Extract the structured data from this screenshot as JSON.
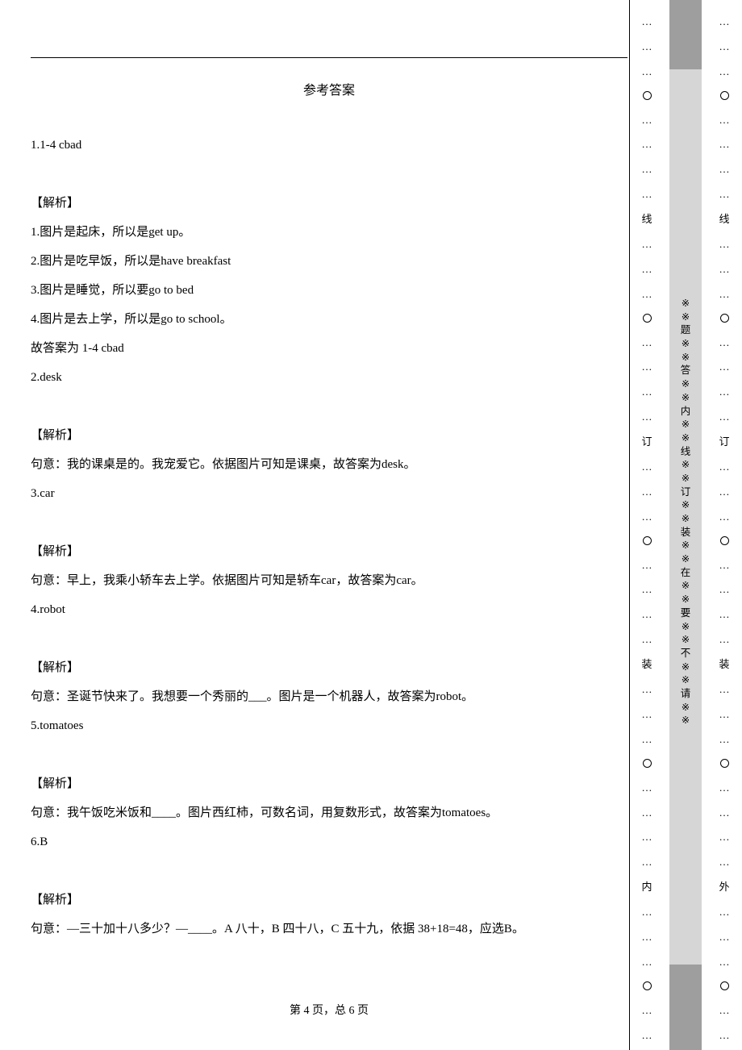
{
  "title": "参考答案",
  "lines": [
    "1.1-4 cbad",
    "",
    "【解析】",
    "1.图片是起床，所以是get up。",
    "2.图片是吃早饭，所以是have breakfast",
    "3.图片是睡觉，所以要go to bed",
    "4.图片是去上学，所以是go to school。",
    "故答案为 1-4 cbad",
    "2.desk",
    "",
    "【解析】",
    "句意：我的课桌是的。我宠爱它。依据图片可知是课桌，故答案为desk。",
    "3.car",
    "",
    "【解析】",
    "句意：早上，我乘小轿车去上学。依据图片可知是轿车car，故答案为car。",
    "4.robot",
    "",
    "【解析】",
    "句意：圣诞节快来了。我想要一个秀丽的___。图片是一个机器人，故答案为robot。",
    "5.tomatoes",
    "",
    "【解析】",
    "句意：我午饭吃米饭和____。图片西红柿，可数名词，用复数形式，故答案为tomatoes。",
    "6.B",
    "",
    "【解析】",
    "句意：—三十加十八多少？—____。A 八十，B 四十八，C 五十九，依据 38+18=48，应选B。"
  ],
  "footer": "第 4 页，总 6 页",
  "marginLeft": [
    "…",
    "…",
    "…",
    "○",
    "…",
    "…",
    "…",
    "…",
    "线",
    "…",
    "…",
    "…",
    "○",
    "…",
    "…",
    "…",
    "…",
    "订",
    "…",
    "…",
    "…",
    "○",
    "…",
    "…",
    "…",
    "…",
    "装",
    "…",
    "…",
    "…",
    "○",
    "…",
    "…",
    "…",
    "…",
    "内",
    "…",
    "…",
    "…",
    "○",
    "…",
    "…"
  ],
  "marginRight": [
    "…",
    "…",
    "…",
    "○",
    "…",
    "…",
    "…",
    "…",
    "线",
    "…",
    "…",
    "…",
    "○",
    "…",
    "…",
    "…",
    "…",
    "订",
    "…",
    "…",
    "…",
    "○",
    "…",
    "…",
    "…",
    "…",
    "装",
    "…",
    "…",
    "…",
    "○",
    "…",
    "…",
    "…",
    "…",
    "外",
    "…",
    "…",
    "…",
    "○",
    "…",
    "…"
  ],
  "marginCenter": [
    "※",
    "※",
    "题",
    "※",
    "※",
    "答",
    "※",
    "※",
    "内",
    "※",
    "※",
    "线",
    "※",
    "※",
    "订",
    "※",
    "※",
    "装",
    "※",
    "※",
    "在",
    "※",
    "※",
    "要",
    "※",
    "※",
    "不",
    "※",
    "※",
    "请",
    "※",
    "※"
  ]
}
